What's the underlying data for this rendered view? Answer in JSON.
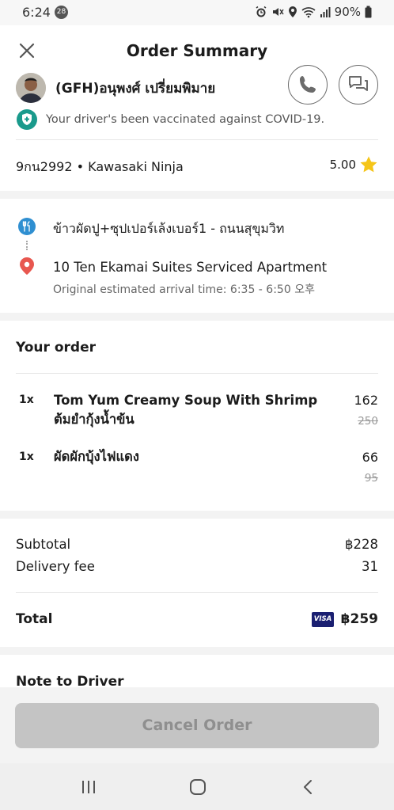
{
  "status_bar": {
    "time": "6:24",
    "notification_count": "28",
    "battery": "90%"
  },
  "header": {
    "title": "Order Summary"
  },
  "driver": {
    "name": "(GFH)อนุพงศ์ เปรี่ยมพิมาย",
    "vaccination_text": "Your driver's been vaccinated against COVID-19.",
    "plate_vehicle": "9กน2992 • Kawasaki Ninja",
    "rating": "5.00"
  },
  "route": {
    "restaurant": "ข้าวผัดปู+ซุปเปอร์เล้งเบอร์1 - ถนนสุขุมวิท",
    "destination": "10 Ten Ekamai Suites Serviced Apartment",
    "eta": "Original estimated arrival time: 6:35 - 6:50 오후"
  },
  "order": {
    "title": "Your order",
    "items": [
      {
        "qty": "1x",
        "name_line1": "Tom Yum Creamy Soup With Shrimp",
        "name_line2": "ต้มยำกุ้งน้ำข้น",
        "price": "162",
        "original_price": "250"
      },
      {
        "qty": "1x",
        "name_line1": "ผัดผักบุ้งไฟแดง",
        "price": "66",
        "original_price": "95"
      }
    ]
  },
  "totals": {
    "subtotal_label": "Subtotal",
    "subtotal_value": "฿228",
    "delivery_label": "Delivery fee",
    "delivery_value": "31",
    "total_label": "Total",
    "payment_method": "VISA",
    "total_value": "฿259"
  },
  "note": {
    "title": "Note to Driver"
  },
  "actions": {
    "cancel_label": "Cancel Order"
  },
  "colors": {
    "accent_teal": "#1a9a8c",
    "restaurant_pin": "#2f8fd1",
    "destination_pin": "#e8574f",
    "star": "#f5c518",
    "visa": "#1a1f71",
    "cancel_disabled": "#c4c4c4"
  },
  "icons": {
    "close": "close-icon",
    "call": "phone-icon",
    "chat": "chat-icon",
    "vaccine": "shield-plus-icon",
    "star": "star-icon",
    "restaurant": "fork-knife-icon",
    "destination": "location-pin-icon",
    "nav_recent": "recent-apps-icon",
    "nav_home": "home-icon",
    "nav_back": "back-icon"
  }
}
